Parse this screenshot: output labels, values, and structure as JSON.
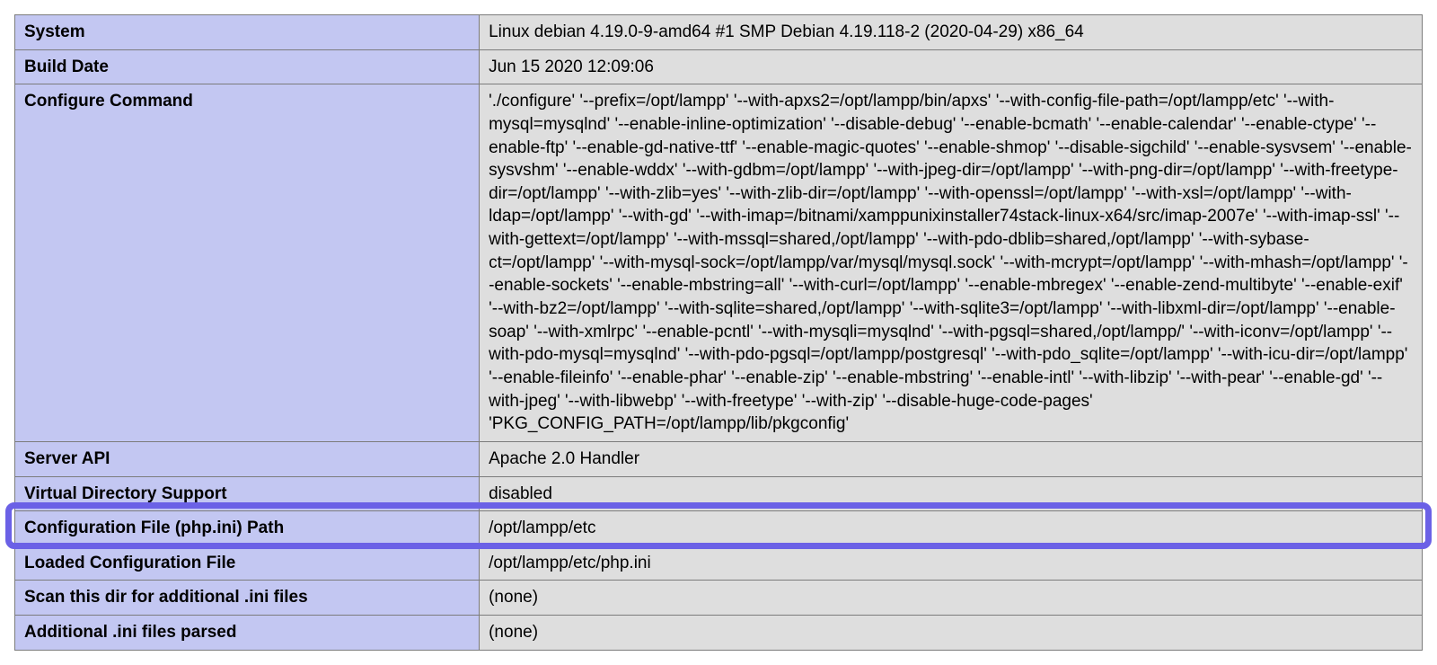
{
  "rows": [
    {
      "key": "System",
      "val": "Linux debian 4.19.0-9-amd64 #1 SMP Debian 4.19.118-2 (2020-04-29) x86_64"
    },
    {
      "key": "Build Date",
      "val": "Jun 15 2020 12:09:06"
    },
    {
      "key": "Configure Command",
      "val": "'./configure' '--prefix=/opt/lampp' '--with-apxs2=/opt/lampp/bin/apxs' '--with-config-file-path=/opt/lampp/etc' '--with-mysql=mysqlnd' '--enable-inline-optimization' '--disable-debug' '--enable-bcmath' '--enable-calendar' '--enable-ctype' '--enable-ftp' '--enable-gd-native-ttf' '--enable-magic-quotes' '--enable-shmop' '--disable-sigchild' '--enable-sysvsem' '--enable-sysvshm' '--enable-wddx' '--with-gdbm=/opt/lampp' '--with-jpeg-dir=/opt/lampp' '--with-png-dir=/opt/lampp' '--with-freetype-dir=/opt/lampp' '--with-zlib=yes' '--with-zlib-dir=/opt/lampp' '--with-openssl=/opt/lampp' '--with-xsl=/opt/lampp' '--with-ldap=/opt/lampp' '--with-gd' '--with-imap=/bitnami/xamppunixinstaller74stack-linux-x64/src/imap-2007e' '--with-imap-ssl' '--with-gettext=/opt/lampp' '--with-mssql=shared,/opt/lampp' '--with-pdo-dblib=shared,/opt/lampp' '--with-sybase-ct=/opt/lampp' '--with-mysql-sock=/opt/lampp/var/mysql/mysql.sock' '--with-mcrypt=/opt/lampp' '--with-mhash=/opt/lampp' '--enable-sockets' '--enable-mbstring=all' '--with-curl=/opt/lampp' '--enable-mbregex' '--enable-zend-multibyte' '--enable-exif' '--with-bz2=/opt/lampp' '--with-sqlite=shared,/opt/lampp' '--with-sqlite3=/opt/lampp' '--with-libxml-dir=/opt/lampp' '--enable-soap' '--with-xmlrpc' '--enable-pcntl' '--with-mysqli=mysqlnd' '--with-pgsql=shared,/opt/lampp/' '--with-iconv=/opt/lampp' '--with-pdo-mysql=mysqlnd' '--with-pdo-pgsql=/opt/lampp/postgresql' '--with-pdo_sqlite=/opt/lampp' '--with-icu-dir=/opt/lampp' '--enable-fileinfo' '--enable-phar' '--enable-zip' '--enable-mbstring' '--enable-intl' '--with-libzip' '--with-pear' '--enable-gd' '--with-jpeg' '--with-libwebp' '--with-freetype' '--with-zip' '--disable-huge-code-pages' 'PKG_CONFIG_PATH=/opt/lampp/lib/pkgconfig'"
    },
    {
      "key": "Server API",
      "val": "Apache 2.0 Handler"
    },
    {
      "key": "Virtual Directory Support",
      "val": "disabled"
    },
    {
      "key": "Configuration File (php.ini) Path",
      "val": "/opt/lampp/etc"
    },
    {
      "key": "Loaded Configuration File",
      "val": "/opt/lampp/etc/php.ini"
    },
    {
      "key": "Scan this dir for additional .ini files",
      "val": "(none)"
    },
    {
      "key": "Additional .ini files parsed",
      "val": "(none)"
    }
  ],
  "highlight_row_index": 5,
  "colors": {
    "key_bg": "#c3c7f2",
    "val_bg": "#dedede",
    "border": "#7c7c7c",
    "highlight": "#6b61e6"
  }
}
